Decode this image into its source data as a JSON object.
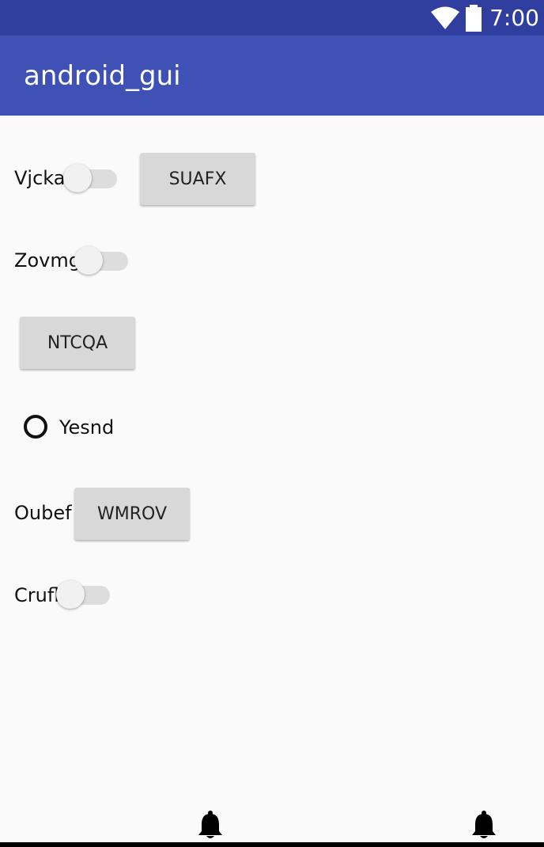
{
  "status": {
    "time": "7:00",
    "icons": [
      "wifi-icon",
      "battery-icon"
    ]
  },
  "app": {
    "title": "android_gui"
  },
  "rows": {
    "row1": {
      "switch_label": "Vjcka",
      "switch_on": false,
      "button_label": "SUAFX"
    },
    "row2": {
      "switch_label": "Zovmg",
      "switch_on": false
    },
    "row3": {
      "button_label": "NTCQA"
    },
    "row4": {
      "radio_label": "Yesnd",
      "radio_checked": false
    },
    "row5": {
      "label": "Oubef",
      "button_label": "WMROV"
    },
    "row6": {
      "switch_label": "Crufl",
      "switch_on": false
    }
  },
  "bottom": {
    "icons": [
      "bell-icon",
      "bell-icon"
    ]
  },
  "colors": {
    "status_bar": "#303f9f",
    "app_bar": "#3f51b5",
    "background": "#fafafa"
  }
}
